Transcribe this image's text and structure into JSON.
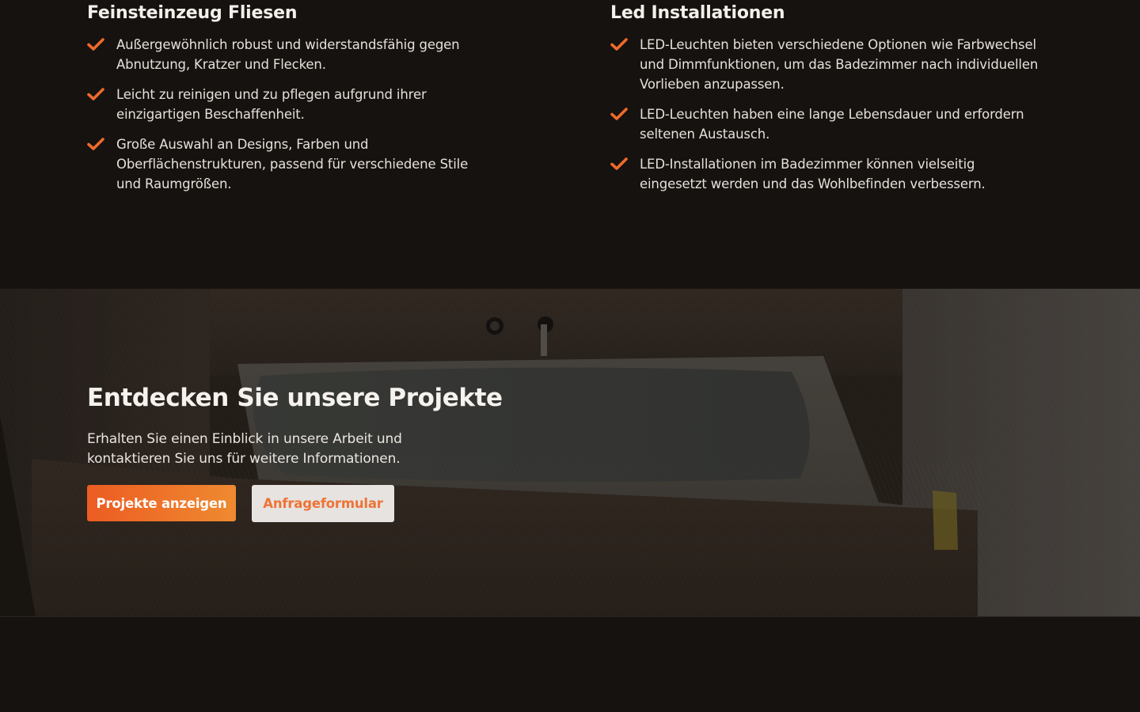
{
  "features": {
    "left": {
      "title": "Feinsteinzeug Fliesen",
      "items": [
        {
          "line1": "Außergewöhnlich robust und widerstandsfähig gegen",
          "line2": "Abnutzung, Kratzer und Flecken."
        },
        {
          "line1": "Leicht zu reinigen und zu pflegen aufgrund ihrer",
          "line2": "einzigartigen Beschaffenheit."
        },
        {
          "line1": "Große Auswahl an Designs, Farben und",
          "line2": "Oberflächenstrukturen, passend für verschiedene Stile",
          "line3": "und Raumgrößen."
        }
      ]
    },
    "right": {
      "title": "Led Installationen",
      "items": [
        {
          "line1": "LED-Leuchten bieten verschiedene Optionen wie Farbwechsel",
          "line2": "und Dimmfunktionen, um das Badezimmer nach individuellen",
          "line3": "Vorlieben anzupassen."
        },
        {
          "line1": "LED-Leuchten haben eine lange Lebensdauer und erfordern",
          "line2": "seltenen Austausch."
        },
        {
          "line1": "LED-Installationen im Badezimmer können vielseitig",
          "line2": "eingesetzt werden und das Wohlbefinden verbessern."
        }
      ]
    },
    "icon": "check-icon"
  },
  "cta": {
    "title": "Entdecken Sie unsere Projekte",
    "text_line1": "Erhalten Sie einen Einblick in unsere Arbeit und",
    "text_line2": "kontaktieren Sie uns für weitere Informationen.",
    "primary_button": "Projekte anzeigen",
    "secondary_button": "Anfrageformular"
  },
  "colors": {
    "background": "#16120f",
    "accent": "#ec5c22",
    "accent_light": "#ef8a30",
    "text": "#ece6e0"
  }
}
